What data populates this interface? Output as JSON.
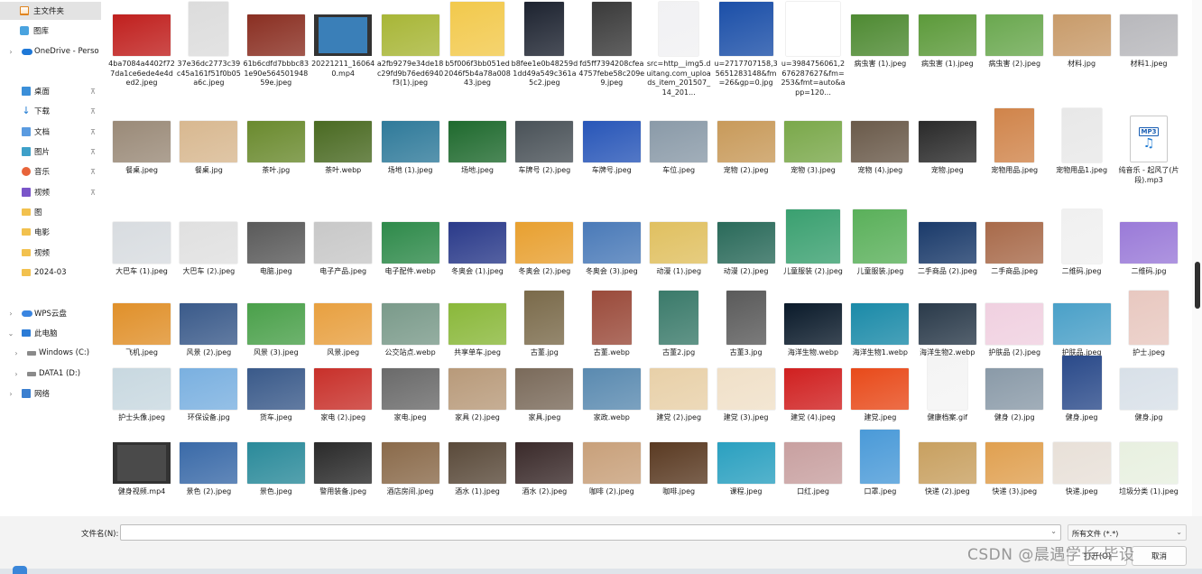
{
  "sidebar": {
    "items": [
      {
        "label": "主文件夹",
        "icon": "home-icon"
      },
      {
        "label": "图库",
        "icon": "gallery-icon"
      },
      {
        "label": "OneDrive - Perso",
        "icon": "cloud-icon"
      },
      {
        "label": "桌面",
        "icon": "desktop-icon"
      },
      {
        "label": "下载",
        "icon": "download-icon"
      },
      {
        "label": "文档",
        "icon": "document-icon"
      },
      {
        "label": "图片",
        "icon": "pictures-icon"
      },
      {
        "label": "音乐",
        "icon": "music-icon"
      },
      {
        "label": "视频",
        "icon": "video-icon"
      },
      {
        "label": "图",
        "icon": "folder-icon"
      },
      {
        "label": "电影",
        "icon": "folder-icon"
      },
      {
        "label": "视频",
        "icon": "folder-icon"
      },
      {
        "label": "2024-03",
        "icon": "folder-icon"
      },
      {
        "label": "WPS云盘",
        "icon": "wps-cloud-icon"
      },
      {
        "label": "此电脑",
        "icon": "computer-icon"
      },
      {
        "label": "Windows (C:)",
        "icon": "drive-icon"
      },
      {
        "label": "DATA1 (D:)",
        "icon": "drive-icon"
      },
      {
        "label": "网络",
        "icon": "network-icon"
      }
    ]
  },
  "files": [
    {
      "name": "4ba7084a4402f727da1ce6ede4e4ded2.jpeg",
      "color": "#c0201e"
    },
    {
      "name": "37e36dc2773c39c45a161f51f0b05a6c.jpeg",
      "color": "#dcdcdc"
    },
    {
      "name": "61b6cdfd7bbbc831e90e56450194859e.jpeg",
      "color": "#8a2f22"
    },
    {
      "name": "20221211_160640.mp4",
      "color": "#3a7fb8"
    },
    {
      "name": "a2fb9279e34de18c29fd9b76ed6940f3(1).jpeg",
      "color": "#a8b637"
    },
    {
      "name": "b5f006f3bb051ed2046f5b4a78a00843.jpeg",
      "color": "#f2c94c"
    },
    {
      "name": "b8fee1e0b48259d1dd49a549c361a5c2.jpeg",
      "color": "#1d2330"
    },
    {
      "name": "fd5ff7394208cfea4757febe58c209e9.jpeg",
      "color": "#3a3a3a"
    },
    {
      "name": "src=http__img5.duitang.com_uploads_item_201507_14_201...",
      "color": "#f1f1f3"
    },
    {
      "name": "u=2717707158,35651283148&fm=26&gp=0.jpg",
      "color": "#1b4fa8"
    },
    {
      "name": "u=3984756061,2676287627&fm=253&fmt=auto&app=120...",
      "color": "#ffffff"
    },
    {
      "name": "病虫害 (1).jpeg",
      "color": "#4e8a32"
    },
    {
      "name": "病虫害 (1).jpeg",
      "color": "#5c9a3a"
    },
    {
      "name": "病虫害 (2).jpeg",
      "color": "#6aa84f"
    },
    {
      "name": "材料.jpg",
      "color": "#c89b6a"
    },
    {
      "name": "材料1.jpeg",
      "color": "#b8b8bc"
    },
    {
      "name": "餐桌.jpeg",
      "color": "#9a8a78"
    },
    {
      "name": "餐桌.jpg",
      "color": "#d8b890"
    },
    {
      "name": "茶叶.jpg",
      "color": "#6a8a2e"
    },
    {
      "name": "茶叶.webp",
      "color": "#4a6a22"
    },
    {
      "name": "场地 (1).jpeg",
      "color": "#2f7a9a"
    },
    {
      "name": "场地.jpeg",
      "color": "#1f6a2e"
    },
    {
      "name": "车牌号 (2).jpeg",
      "color": "#4a5258"
    },
    {
      "name": "车牌号.jpeg",
      "color": "#2856b8"
    },
    {
      "name": "车位.jpeg",
      "color": "#8a9aa8"
    },
    {
      "name": "宠物 (2).jpeg",
      "color": "#c89a5a"
    },
    {
      "name": "宠物 (3).jpeg",
      "color": "#7aa84a"
    },
    {
      "name": "宠物 (4).jpeg",
      "color": "#6a5a4a"
    },
    {
      "name": "宠物.jpeg",
      "color": "#2a2a2a"
    },
    {
      "name": "宠物用品.jpeg",
      "color": "#d0844a"
    },
    {
      "name": "宠物用品1.jpeg",
      "color": "#e8e8e8"
    },
    {
      "name": "纯音乐 - 起风了(片段).mp3",
      "color": "#ffffff"
    },
    {
      "name": "大巴车 (1).jpeg",
      "color": "#d8dce0"
    },
    {
      "name": "大巴车 (2).jpeg",
      "color": "#e0e0e0"
    },
    {
      "name": "电脑.jpeg",
      "color": "#5a5a5a"
    },
    {
      "name": "电子产品.jpeg",
      "color": "#c8c8c8"
    },
    {
      "name": "电子配件.webp",
      "color": "#2e8a4a"
    },
    {
      "name": "冬奥会 (1).jpeg",
      "color": "#2a3a8a"
    },
    {
      "name": "冬奥会 (2).jpeg",
      "color": "#e8a030"
    },
    {
      "name": "冬奥会 (3).jpeg",
      "color": "#4a7ab8"
    },
    {
      "name": "动漫 (1).jpeg",
      "color": "#e0c060"
    },
    {
      "name": "动漫 (2).jpeg",
      "color": "#2a6a5a"
    },
    {
      "name": "儿童服装 (2).jpeg",
      "color": "#3aa070"
    },
    {
      "name": "儿童服装.jpeg",
      "color": "#5ab05a"
    },
    {
      "name": "二手商品 (2).jpeg",
      "color": "#1a3a6a"
    },
    {
      "name": "二手商品.jpeg",
      "color": "#a86a4a"
    },
    {
      "name": "二维码.jpeg",
      "color": "#f0f0f0"
    },
    {
      "name": "二维码.jpg",
      "color": "#9a7ad8"
    },
    {
      "name": "飞机.jpeg",
      "color": "#e0902a"
    },
    {
      "name": "风景 (2).jpeg",
      "color": "#3a5a8a"
    },
    {
      "name": "风景 (3).jpeg",
      "color": "#4aa04a"
    },
    {
      "name": "风景.jpeg",
      "color": "#e8a040"
    },
    {
      "name": "公交站点.webp",
      "color": "#7a9a8a"
    },
    {
      "name": "共享单车.jpeg",
      "color": "#8ab83a"
    },
    {
      "name": "古董.jpg",
      "color": "#7a6a4a"
    },
    {
      "name": "古董.webp",
      "color": "#9a4a3a"
    },
    {
      "name": "古董2.jpg",
      "color": "#3a7a6a"
    },
    {
      "name": "古董3.jpg",
      "color": "#5a5a5a"
    },
    {
      "name": "海洋生物.webp",
      "color": "#0a1a2a"
    },
    {
      "name": "海洋生物1.webp",
      "color": "#1a8aa8"
    },
    {
      "name": "海洋生物2.webp",
      "color": "#2a3a4a"
    },
    {
      "name": "护肤品 (2).jpeg",
      "color": "#f0d0e0"
    },
    {
      "name": "护肤品.jpeg",
      "color": "#4aa0c8"
    },
    {
      "name": "护士.jpeg",
      "color": "#e8c8c0"
    },
    {
      "name": "护士头像.jpeg",
      "color": "#c8d8e0"
    },
    {
      "name": "环保设备.jpg",
      "color": "#7ab0e0"
    },
    {
      "name": "货车.jpeg",
      "color": "#3a5a8a"
    },
    {
      "name": "家电 (2).jpeg",
      "color": "#c8302a"
    },
    {
      "name": "家电.jpeg",
      "color": "#6a6a6a"
    },
    {
      "name": "家具 (2).jpeg",
      "color": "#b89a7a"
    },
    {
      "name": "家具.jpeg",
      "color": "#7a6a5a"
    },
    {
      "name": "家政.webp",
      "color": "#5a8ab0"
    },
    {
      "name": "建党 (2).jpeg",
      "color": "#e8d0a8"
    },
    {
      "name": "建党 (3).jpeg",
      "color": "#f0e0c8"
    },
    {
      "name": "建党 (4).jpeg",
      "color": "#d02020"
    },
    {
      "name": "建党.jpeg",
      "color": "#e84a1a"
    },
    {
      "name": "健康档案.gif",
      "color": "#f4f4f4"
    },
    {
      "name": "健身 (2).jpg",
      "color": "#8a9aa8"
    },
    {
      "name": "健身.jpeg",
      "color": "#2a4a8a"
    },
    {
      "name": "健身.jpg",
      "color": "#d8e0e8"
    },
    {
      "name": "健身视频.mp4",
      "color": "#4a4a4a"
    },
    {
      "name": "景色 (2).jpeg",
      "color": "#3a6aa8"
    },
    {
      "name": "景色.jpeg",
      "color": "#2a8a9a"
    },
    {
      "name": "警用装备.jpeg",
      "color": "#2a2a2a"
    },
    {
      "name": "酒店房间.jpeg",
      "color": "#8a6a4a"
    },
    {
      "name": "酒水 (1).jpeg",
      "color": "#5a4a3a"
    },
    {
      "name": "酒水 (2).jpeg",
      "color": "#3a2a2a"
    },
    {
      "name": "咖啡 (2).jpeg",
      "color": "#c8a07a"
    },
    {
      "name": "咖啡.jpeg",
      "color": "#5a3a22"
    },
    {
      "name": "课程.jpeg",
      "color": "#2aa0c0"
    },
    {
      "name": "口红.jpeg",
      "color": "#c8a0a0"
    },
    {
      "name": "口罩.jpeg",
      "color": "#4a9ad8"
    },
    {
      "name": "快递 (2).jpeg",
      "color": "#c8a060"
    },
    {
      "name": "快递 (3).jpeg",
      "color": "#e0a050"
    },
    {
      "name": "快递.jpeg",
      "color": "#e8e0d8"
    },
    {
      "name": "垃圾分类 (1).jpeg",
      "color": "#e8f0e0"
    }
  ],
  "bottom": {
    "filename_label": "文件名(N):",
    "filename_value": "",
    "filetype": "所有文件 (*.*)",
    "open_label": "打开(O)",
    "cancel_label": "取消",
    "watermark": "CSDN @晨遇学长-毕设"
  }
}
